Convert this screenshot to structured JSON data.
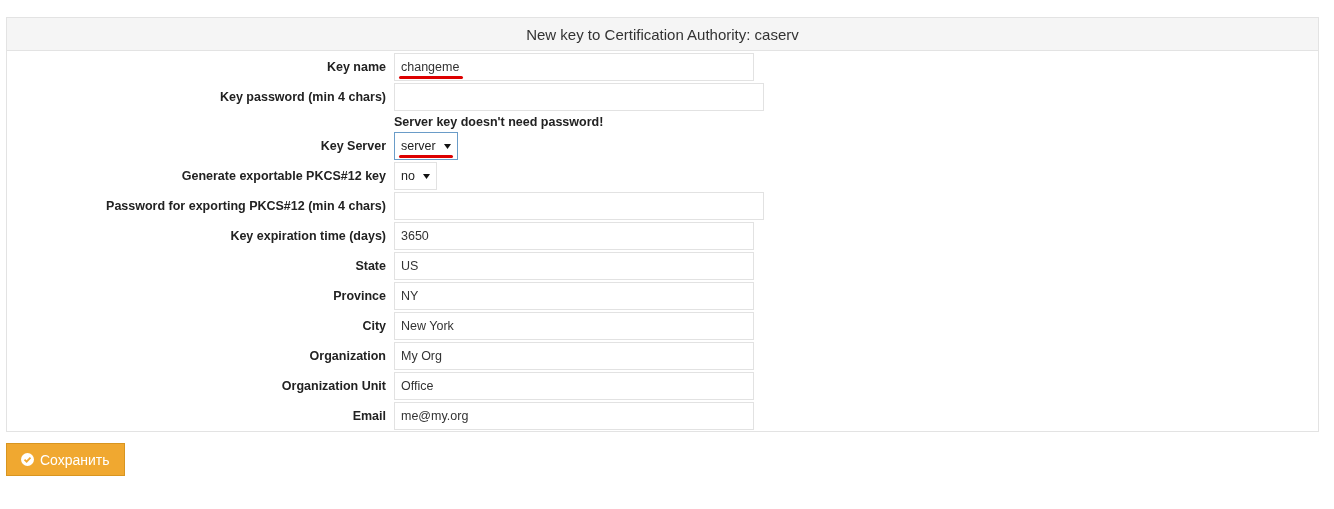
{
  "header": {
    "title": "New key to Certification Authority: caserv"
  },
  "rows": [
    {
      "kind": "text",
      "label": "Key name",
      "value": "changeme",
      "underlined": true
    },
    {
      "kind": "password",
      "label": "Key password (min 4 chars)"
    },
    {
      "kind": "note",
      "text": "Server key doesn't need password!"
    },
    {
      "kind": "select",
      "label": "Key Server",
      "value": "server",
      "focused": true,
      "underlined": true
    },
    {
      "kind": "select",
      "label": "Generate exportable PKCS#12 key",
      "value": "no",
      "focused": false,
      "underlined": false
    },
    {
      "kind": "password",
      "label": "Password for exporting PKCS#12 (min 4 chars)"
    },
    {
      "kind": "text",
      "label": "Key expiration time (days)",
      "value": "3650",
      "underlined": false
    },
    {
      "kind": "text",
      "label": "State",
      "value": "US",
      "underlined": false
    },
    {
      "kind": "text",
      "label": "Province",
      "value": "NY",
      "underlined": false
    },
    {
      "kind": "text",
      "label": "City",
      "value": "New York",
      "underlined": false
    },
    {
      "kind": "text",
      "label": "Organization",
      "value": "My Org",
      "underlined": false
    },
    {
      "kind": "text",
      "label": "Organization Unit",
      "value": "Office",
      "underlined": false
    },
    {
      "kind": "text",
      "label": "Email",
      "value": "me@my.org",
      "underlined": false
    }
  ],
  "save_button": {
    "label": "Сохранить"
  }
}
